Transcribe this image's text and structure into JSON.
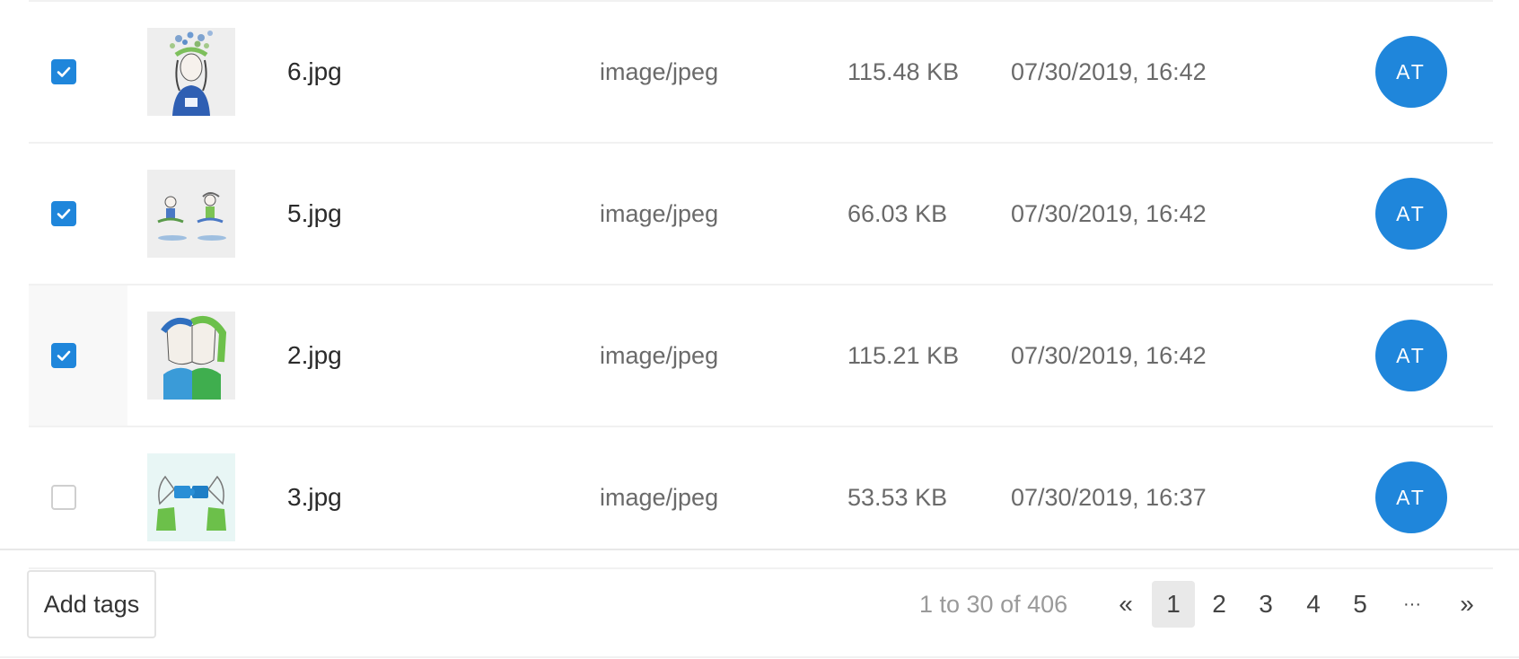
{
  "rows": [
    {
      "checked": true,
      "name": "6.jpg",
      "type": "image/jpeg",
      "size": "115.48 KB",
      "date": "07/30/2019, 16:42",
      "avatar": "AT",
      "thumb_icon": "woman-flowers-illustration"
    },
    {
      "checked": true,
      "name": "5.jpg",
      "type": "image/jpeg",
      "size": "66.03 KB",
      "date": "07/30/2019, 16:42",
      "avatar": "AT",
      "thumb_icon": "meditating-couple-illustration"
    },
    {
      "checked": true,
      "name": "2.jpg",
      "type": "image/jpeg",
      "size": "115.21 KB",
      "date": "07/30/2019, 16:42",
      "avatar": "AT",
      "thumb_icon": "two-faces-illustration"
    },
    {
      "checked": false,
      "name": "3.jpg",
      "type": "image/jpeg",
      "size": "53.53 KB",
      "date": "07/30/2019, 16:37",
      "avatar": "AT",
      "thumb_icon": "puzzle-hands-illustration"
    }
  ],
  "footer": {
    "add_tags_label": "Add tags",
    "range_text": "1 to 30 of 406",
    "pagination": {
      "first": "«",
      "pages": [
        "1",
        "2",
        "3",
        "4",
        "5"
      ],
      "ellipsis": "···",
      "last": "»",
      "current": "1"
    }
  },
  "colors": {
    "accent": "#1f86db",
    "border": "#f1f1f1",
    "muted_text": "#6a6a6a"
  }
}
